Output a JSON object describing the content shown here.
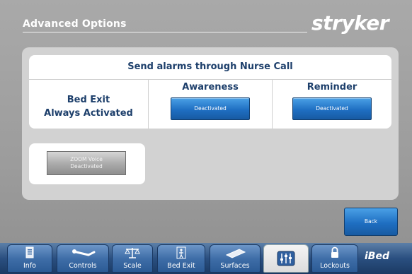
{
  "header": {
    "title": "Advanced Options",
    "logo_text": "stryker"
  },
  "alarms": {
    "title": "Send alarms through Nurse Call",
    "bed_exit_line1": "Bed Exit",
    "bed_exit_line2": "Always Activated",
    "awareness": {
      "label": "Awareness",
      "button": "Deactivated"
    },
    "reminder": {
      "label": "Reminder",
      "button": "Deactivated"
    }
  },
  "zoom": {
    "line1": "ZOOM Voice",
    "line2": "Deactivated"
  },
  "back_button": "Back",
  "nav": {
    "tabs": [
      {
        "label": "Info",
        "icon": "info-icon"
      },
      {
        "label": "Controls",
        "icon": "patient-controls-icon"
      },
      {
        "label": "Scale",
        "icon": "scale-icon"
      },
      {
        "label": "Bed Exit",
        "icon": "bed-exit-icon"
      },
      {
        "label": "Surfaces",
        "icon": "surfaces-icon"
      },
      {
        "label": "",
        "icon": "sliders-icon",
        "active": true
      },
      {
        "label": "Lockouts",
        "icon": "lock-icon"
      }
    ],
    "brand": "iBed"
  },
  "colors": {
    "background": "#9e9e9e",
    "panel": "#d2d2d2",
    "title_text": "#1d3f6b",
    "button_blue": "#1f6fc2",
    "nav_blue": "#2a4f80"
  }
}
